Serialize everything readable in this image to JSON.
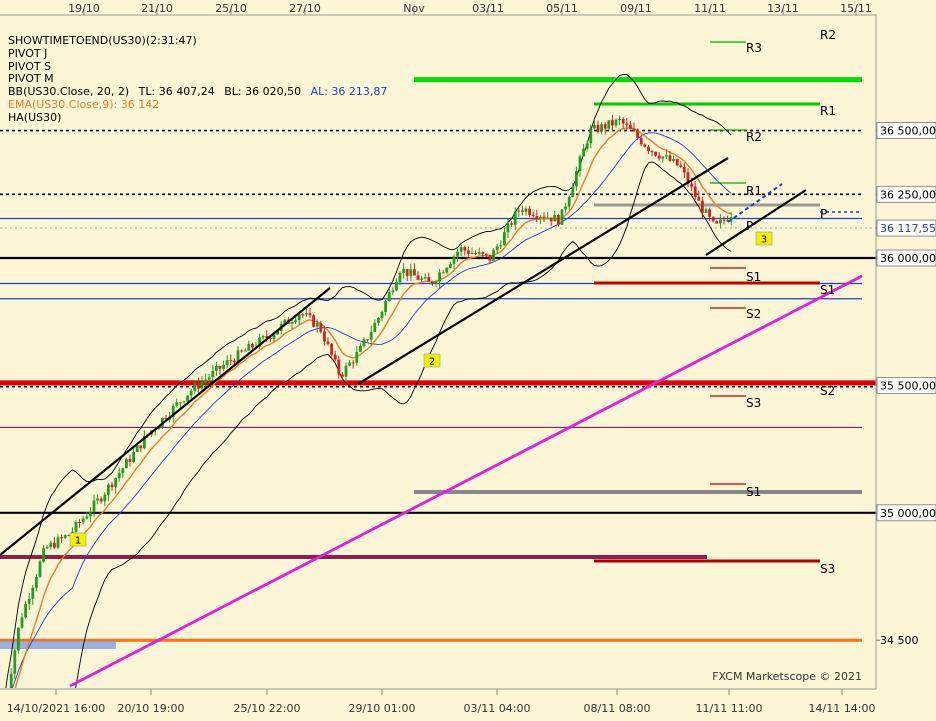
{
  "top_axis_labels": [
    "19/10",
    "21/10",
    "25/10",
    "27/10",
    "Nov",
    "03/11",
    "05/11",
    "09/11",
    "11/11",
    "13/11",
    "15/11"
  ],
  "bottom_axis_labels": [
    "14/10/2021 16:00",
    "20/10 19:00",
    "25/10 22:00",
    "29/10 01:00",
    "03/11 04:00",
    "08/11 08:00",
    "11/11 11:00",
    "14/11 14:00"
  ],
  "info_lines": [
    {
      "text": "SHOWTIMETOEND(US30)(2:31:47)",
      "color": "#000000"
    },
    {
      "text": "PIVOT J",
      "color": "#000000"
    },
    {
      "text": "PIVOT S",
      "color": "#000000"
    },
    {
      "text": "PIVOT M",
      "color": "#000000"
    }
  ],
  "bb_line": {
    "prefix": "BB(US30.Close, 20, 2)",
    "tl": "TL: 36 407,24",
    "bl": "BL: 36 020,50",
    "al": "AL: 36 213,87"
  },
  "ema_line": "EMA(US30.Close,9): 36 142",
  "ha_line": "HA(US30)",
  "price_labels": [
    {
      "text": "36 500,00",
      "price": 36500,
      "boxed": true
    },
    {
      "text": "36 250,00",
      "price": 36250,
      "boxed": true
    },
    {
      "text": "36 117,55",
      "price": 36117.55,
      "boxed": true,
      "color": "#1a3fcf"
    },
    {
      "text": "36 000,00",
      "price": 36000,
      "boxed": true
    },
    {
      "text": "35 500,00",
      "price": 35500,
      "boxed": true
    },
    {
      "text": "35 000,00",
      "price": 35000,
      "boxed": true
    },
    {
      "text": "34 500",
      "price": 34500,
      "boxed": false
    }
  ],
  "pivot_labels": [
    {
      "text": "R2",
      "set": "J"
    },
    {
      "text": "R3",
      "set": "S"
    },
    {
      "text": "R1",
      "set": "S"
    },
    {
      "text": "R2",
      "set": "M"
    },
    {
      "text": "R1",
      "set": "J"
    },
    {
      "text": "P",
      "set": "J"
    },
    {
      "text": "P",
      "set": "S"
    },
    {
      "text": "S1",
      "set": "J"
    },
    {
      "text": "S1",
      "set": "S"
    },
    {
      "text": "S2",
      "set": "J"
    },
    {
      "text": "S2",
      "set": "S"
    },
    {
      "text": "S3",
      "set": "J"
    },
    {
      "text": "S1",
      "set": "M"
    },
    {
      "text": "S3",
      "set": "S"
    }
  ],
  "markers": [
    "1",
    "2",
    "3"
  ],
  "watermark": "FXCM Marketscope © 2021",
  "colors": {
    "background": "#fdf6d6",
    "bull": "#1f9e1f",
    "bear": "#d42020",
    "ema": "#f07a2a",
    "bollinger": "#000000",
    "basis": "#1a3fcf",
    "trend_magenta": "#e020e0"
  },
  "chart_data": {
    "type": "candlestick",
    "instrument": "US30",
    "timeframe": "H1",
    "ylim": [
      34450,
      36780
    ],
    "x_range": [
      "14/10/2021 16:00",
      "15/11/2021 00:00"
    ],
    "current_price": 36117.55,
    "horizontal_levels": [
      {
        "price": 36700,
        "color": "#00e000",
        "style": "solid"
      },
      {
        "price": 36500,
        "color": "#000000",
        "style": "dotted"
      },
      {
        "price": 36250,
        "color": "#000000",
        "style": "dotted"
      },
      {
        "price": 36155,
        "color": "#1a3fcf",
        "style": "solid"
      },
      {
        "price": 36000,
        "color": "#000000",
        "style": "solid"
      },
      {
        "price": 35900,
        "color": "#1a3fcf",
        "style": "solid"
      },
      {
        "price": 35840,
        "color": "#1a3fcf",
        "style": "solid"
      },
      {
        "price": 35510,
        "color": "#e00000",
        "style": "solid"
      },
      {
        "price": 35495,
        "color": "#000000",
        "style": "dotted"
      },
      {
        "price": 35335,
        "color": "#8a2050",
        "style": "solid"
      },
      {
        "price": 35000,
        "color": "#000000",
        "style": "solid"
      },
      {
        "price": 34500,
        "color": "#ff7010",
        "style": "solid"
      }
    ],
    "candles_approx": [
      {
        "date": "14/10",
        "open": 34800,
        "close": 35300
      },
      {
        "date": "15/10",
        "open": 35300,
        "close": 35290
      },
      {
        "date": "18/10",
        "open": 35290,
        "close": 35420
      },
      {
        "date": "19/10",
        "open": 35420,
        "close": 35460
      },
      {
        "date": "20/10",
        "open": 35460,
        "close": 35600
      },
      {
        "date": "21/10",
        "open": 35600,
        "close": 35580
      },
      {
        "date": "22/10",
        "open": 35580,
        "close": 35690
      },
      {
        "date": "25/10",
        "open": 35690,
        "close": 35760
      },
      {
        "date": "26/10",
        "open": 35760,
        "close": 35780
      },
      {
        "date": "27/10",
        "open": 35780,
        "close": 35640
      },
      {
        "date": "28/10",
        "open": 35640,
        "close": 35730
      },
      {
        "date": "29/10",
        "open": 35730,
        "close": 35820
      },
      {
        "date": "01/11",
        "open": 35820,
        "close": 35920
      },
      {
        "date": "02/11",
        "open": 35920,
        "close": 36050
      },
      {
        "date": "03/11",
        "open": 36050,
        "close": 36140
      },
      {
        "date": "04/11",
        "open": 36140,
        "close": 36120
      },
      {
        "date": "05/11",
        "open": 36120,
        "close": 36330
      },
      {
        "date": "08/11",
        "open": 36330,
        "close": 36430
      },
      {
        "date": "09/11",
        "open": 36430,
        "close": 36320
      },
      {
        "date": "10/11",
        "open": 36320,
        "close": 36080
      },
      {
        "date": "11/11",
        "open": 36080,
        "close": 36117
      }
    ]
  }
}
